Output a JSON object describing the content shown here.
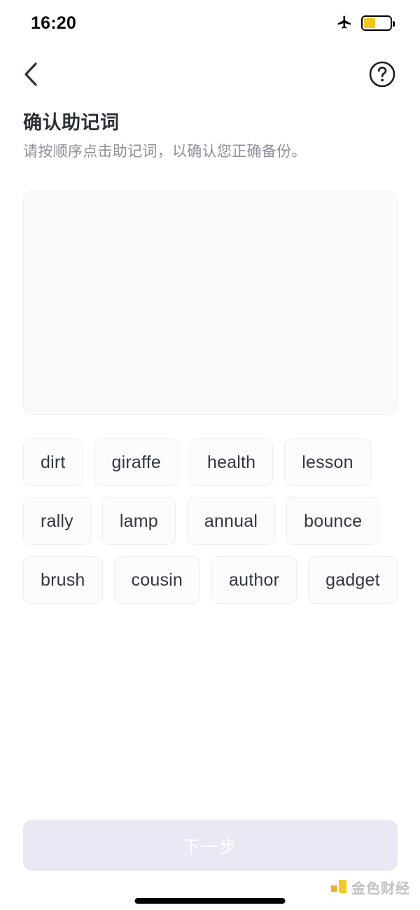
{
  "status_bar": {
    "time": "16:20",
    "airplane_icon": "airplane-mode-icon",
    "battery_icon": "battery-icon",
    "battery_level_percent": 45,
    "battery_color": "#f5c518"
  },
  "nav_bar": {
    "back_icon": "chevron-left-icon",
    "help_icon": "question-mark-circle-icon"
  },
  "header": {
    "title": "确认助记词",
    "subtitle": "请按顺序点击助记词，以确认您正确备份。"
  },
  "drop_zone": {
    "selected_words": [],
    "background_color": "#fafafb"
  },
  "word_pool": {
    "words": [
      "dirt",
      "giraffe",
      "health",
      "lesson",
      "rally",
      "lamp",
      "annual",
      "bounce",
      "brush",
      "cousin",
      "author",
      "gadget"
    ]
  },
  "footer": {
    "next_label": "下一步",
    "next_enabled": false,
    "next_bg_color": "#e9e9f6"
  },
  "watermark": {
    "text": "金色财经",
    "logo_icon": "jinse-logo-icon",
    "logo_colors": [
      "#f5a623",
      "#f5c518"
    ]
  },
  "home_indicator": {
    "icon": "home-indicator-bar"
  }
}
